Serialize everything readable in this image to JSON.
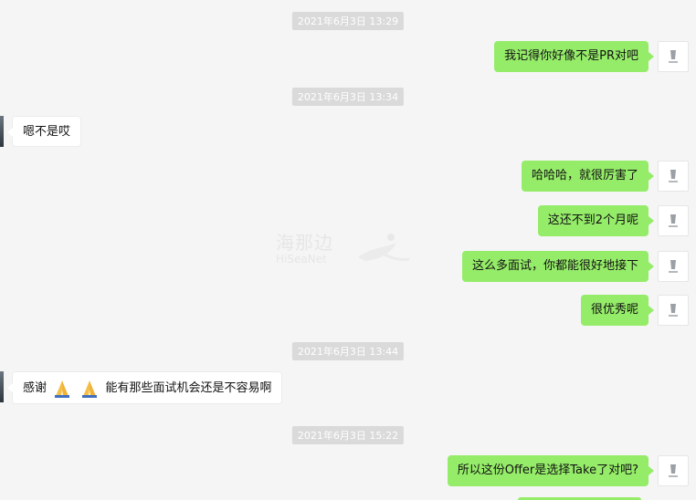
{
  "messages": [
    {
      "timestamp": "2021年6月3日  13:29"
    },
    {
      "out_1": "我记得你好像不是PR对吧"
    },
    {
      "timestamp": "2021年6月3日  13:34"
    },
    {
      "in_1": "嗯不是哎"
    },
    {
      "out_2": "哈哈哈，就很厉害了"
    },
    {
      "out_3": "这还不到2个月呢"
    },
    {
      "out_4": "这么多面试，你都能很好地接下"
    },
    {
      "out_5": "很优秀呢"
    },
    {
      "timestamp": "2021年6月3日  13:44"
    },
    {
      "in_2": {
        "prefix": "感谢",
        "suffix": "能有那些面试机会还是不容易啊",
        "emoji": "folded-hands"
      }
    },
    {
      "timestamp": "2021年6月3日  15:22"
    },
    {
      "out_6": "所以这份Offer是选择Take了对吧?"
    }
  ],
  "ts1": "2021年6月3日  13:29",
  "ts2": "2021年6月3日  13:34",
  "ts3": "2021年6月3日  13:44",
  "ts4": "2021年6月3日  15:22",
  "m1": "我记得你好像不是PR对吧",
  "m2": "嗯不是哎",
  "m3": "哈哈哈，就很厉害了",
  "m4": "这还不到2个月呢",
  "m5": "这么多面试，你都能很好地接下",
  "m6": "很优秀呢",
  "m7_prefix": "感谢",
  "m7_suffix": "能有那些面试机会还是不容易啊",
  "m8": "所以这份Offer是选择Take了对吧?",
  "watermark": {
    "line1": "海那边",
    "line2": "HiSeaNet"
  },
  "colors": {
    "outgoing_bubble": "#95ec69",
    "incoming_bubble": "#ffffff",
    "background": "#f5f5f5",
    "timestamp_bg": "#dadada"
  }
}
